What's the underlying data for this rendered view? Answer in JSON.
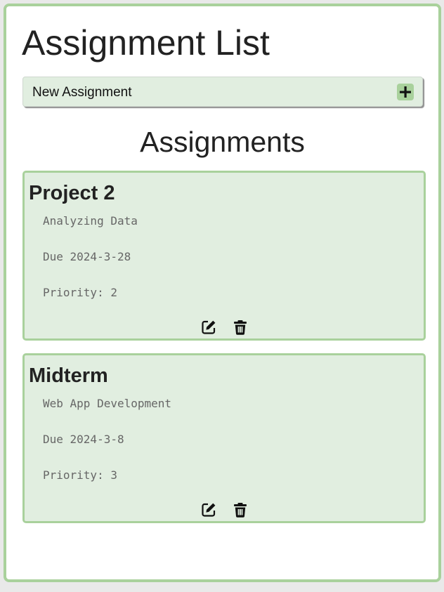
{
  "page": {
    "title": "Assignment List",
    "section_heading": "Assignments"
  },
  "new_assignment": {
    "label": "New Assignment",
    "add_icon": "plus-icon"
  },
  "assignments": [
    {
      "title": "Project 2",
      "description": "Analyzing Data",
      "due": "Due 2024-3-28",
      "priority": "Priority: 2",
      "edit_icon": "edit-icon",
      "delete_icon": "trash-icon"
    },
    {
      "title": "Midterm",
      "description": "Web App Development",
      "due": "Due 2024-3-8",
      "priority": "Priority: 3",
      "edit_icon": "edit-icon",
      "delete_icon": "trash-icon"
    }
  ],
  "colors": {
    "accent_border": "#a9d19c",
    "card_background": "#e1eee0",
    "text_dark": "#222222",
    "text_muted": "#666666"
  }
}
